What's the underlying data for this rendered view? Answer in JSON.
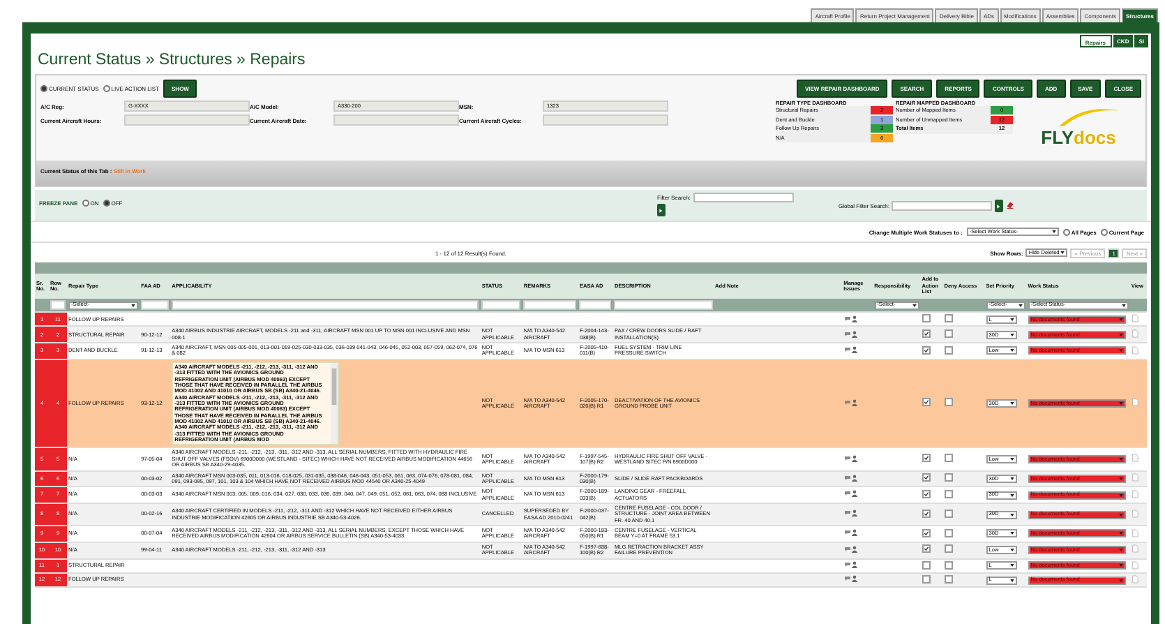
{
  "top_tabs": [
    {
      "label": "Aircraft Profile",
      "selected": false
    },
    {
      "label": "Return Project Management",
      "selected": false
    },
    {
      "label": "Delivery Bible",
      "selected": false
    },
    {
      "label": "ADs",
      "selected": false
    },
    {
      "label": "Modifications",
      "selected": false
    },
    {
      "label": "Assemblies",
      "selected": false
    },
    {
      "label": "Components",
      "selected": false
    },
    {
      "label": "Structures",
      "selected": true
    }
  ],
  "sub_tabs": [
    {
      "label": "Repairs",
      "selected": true
    },
    {
      "label": "CKD",
      "selected": false
    },
    {
      "label": "SI",
      "selected": false
    }
  ],
  "breadcrumb": "Current Status » Structures » Repairs",
  "view_options": [
    {
      "label": "CURRENT STATUS",
      "selected": true
    },
    {
      "label": "LIVE ACTION LIST",
      "selected": false
    }
  ],
  "show_button": "SHOW",
  "action_buttons": [
    "VIEW REPAIR DASHBOARD",
    "SEARCH",
    "REPORTS",
    "CONTROLS",
    "ADD",
    "SAVE",
    "CLOSE"
  ],
  "aircraft_fields": [
    {
      "label": "A/C Reg:",
      "value": "G-XXXX"
    },
    {
      "label": "A/C Model:",
      "value": "A330-200"
    },
    {
      "label": "MSN:",
      "value": "1323"
    },
    {
      "label": "Current Aircraft Hours:"
    },
    {
      "label": "Current Aircraft Date:"
    },
    {
      "label": "Current Aircraft Cycles:"
    }
  ],
  "repair_type_dashboard": {
    "title": "REPAIR TYPE DASHBOARD",
    "items": [
      {
        "label": "Structural Repairs",
        "count": "2",
        "color": "#e8242b"
      },
      {
        "label": "Dent and Buckle",
        "count": "1",
        "color": "#8fa6d6"
      },
      {
        "label": "Follow Up Repairs",
        "count": "3",
        "color": "#2e9b45"
      },
      {
        "label": "N/A",
        "count": "6",
        "color": "#f5a623"
      }
    ]
  },
  "repair_mapped_dashboard": {
    "title": "REPAIR MAPPED DASHBOARD",
    "items": [
      {
        "label": "Number of Mapped Items",
        "count": "0",
        "color": "#2e9b45"
      },
      {
        "label": "Number of Unmapped Items",
        "count": "12",
        "color": "#e8242b"
      }
    ],
    "total": {
      "label": "Total Items",
      "count": "12"
    }
  },
  "logo": {
    "part_1": "FLY",
    "part_2": "docs"
  },
  "tab_status": {
    "label": "Current Status of this Tab :",
    "value": "Still in Work"
  },
  "freeze_pane": {
    "label": "FREEZE PANE",
    "options": [
      {
        "label": "ON",
        "selected": false
      },
      {
        "label": "OFF",
        "selected": true
      }
    ]
  },
  "filter_search": {
    "label": "Filter Search:"
  },
  "global_filter_search": {
    "label": "Global Filter Search:"
  },
  "bulk_status": {
    "label": "Change Multiple Work Statuses to :",
    "select": "-Select Work Status-",
    "scopes": [
      {
        "label": "All Pages",
        "selected": false
      },
      {
        "label": "Current Page",
        "selected": false
      }
    ]
  },
  "results": "1 - 12 of 12 Result(s) Found.",
  "show_rows": {
    "label": "Show Rows:",
    "value": "Hide Deleted"
  },
  "pagination": {
    "previous": "« Previous",
    "pages": [
      {
        "label": "1",
        "selected": true
      }
    ],
    "next": "Next »"
  },
  "table": {
    "columns": [
      "Sr. No.",
      "Row No.",
      "Repair Type",
      "FAA AD",
      "APPLICABILITY",
      "STATUS",
      "REMARKS",
      "EASA AD",
      "DESCRIPTION",
      "Add Note",
      "Manage Issues",
      "Responsibility",
      "Add to Action List",
      "Deny Access",
      "Set Priority",
      "Work Status",
      "View"
    ],
    "filters": [
      {
        "kind": "none"
      },
      {
        "kind": "input"
      },
      {
        "kind": "select",
        "value": "-Select-"
      },
      {
        "kind": "input"
      },
      {
        "kind": "input"
      },
      {
        "kind": "input"
      },
      {
        "kind": "input"
      },
      {
        "kind": "input"
      },
      {
        "kind": "input"
      },
      {
        "kind": "none"
      },
      {
        "kind": "none"
      },
      {
        "kind": "select",
        "value": "-Select-"
      },
      {
        "kind": "none"
      },
      {
        "kind": "none"
      },
      {
        "kind": "select",
        "value": "-Select-"
      },
      {
        "kind": "select",
        "value": "-Select Status-"
      },
      {
        "kind": "none"
      }
    ],
    "rows": [
      {
        "sr": "1",
        "row": "11",
        "repair_type": "FOLLOW UP REPAIRS",
        "scrollable": false,
        "action_list": false,
        "deny_access": false,
        "priority": "L",
        "work_status": "No documents found",
        "selected": false
      },
      {
        "sr": "2",
        "row": "2",
        "repair_type": "STRUCTURAL REPAIR",
        "faa_ad": "90-12-12",
        "applicability": "A340 AIRBUS INDUSTRIE AIRCRAFT, MODELS -211 and -311, AIRCRAFT MSN 001 UP TO MSN 001 INCLUSIVE AND MSN 008-1",
        "scrollable": false,
        "status": "NOT APPLICABLE",
        "remarks": "N/A TO A340-542 AIRCRAFT",
        "easa_ad": "F-2004-143-038(B)",
        "description": "PAX / CREW DOORS SLIDE / RAFT INSTALLATION(S)",
        "action_list": true,
        "deny_access": false,
        "priority": "30D",
        "work_status": "No documents found",
        "selected": false
      },
      {
        "sr": "3",
        "row": "3",
        "repair_type": "DENT AND BUCKLE",
        "faa_ad": "91-12-13",
        "applicability": "A340 AIRCRAFT, MSN 005-005-001, 013-001-019-025-030-033-035, 036-039 041-043, 046-045, 052-003, 057-059, 062-074, 076 & 082",
        "scrollable": false,
        "status": "NOT APPLICABLE",
        "remarks": "N/A TO MSN 613",
        "easa_ad": "F-2005-410-011(B)",
        "description": "FUEL SYSTEM - TRIM LINE PRESSURE SWITCH",
        "action_list": true,
        "deny_access": false,
        "priority": "Low",
        "work_status": "No documents found",
        "selected": false
      },
      {
        "sr": "4",
        "row": "4",
        "repair_type": "FOLLOW UP REPAIRS",
        "faa_ad": "93-12-12",
        "applicability": "A340 AIRCRAFT MODELS -211, -212, -213, -311, -312 AND -313 FITTED WITH THE AVIONICS GROUND REFRIGERATION UNIT (AIRBUS MOD 40063) EXCEPT THOSE THAT HAVE RECEIVED IN PARALLEL THE AIRBUS MOD 41002 AND 41010 OR AIRBUS SB (SB) A340-21-4046. A340 AIRCRAFT MODELS -211, -212, -213, -311, -312 AND -313 FITTED WITH THE AVIONICS GROUND REFRIGERATION UNIT (AIRBUS MOD 40063) EXCEPT THOSE THAT HAVE RECEIVED IN PARALLEL THE AIRBUS MOD 41002 AND 41010 OR AIRBUS SB (SB) A340-21-4046. A340 AIRCRAFT MODELS -211, -212, -213, -311, -312 AND -313 FITTED WITH THE AVIONICS GROUND REFRIGERATION UNIT (AIRBUS MOD",
        "scrollable": true,
        "status": "NOT APPLICABLE",
        "remarks": "N/A TO A340-542 AIRCRAFT",
        "easa_ad": "F-2005-170-020(B) R1",
        "description": "DEACTIVATION OF THE AVIONICS GROUND PROBE UNIT",
        "action_list": true,
        "deny_access": false,
        "priority": "30D",
        "work_status": "No documents found",
        "selected": true
      },
      {
        "sr": "5",
        "row": "5",
        "repair_type": "N/A",
        "faa_ad": "97-05-04",
        "applicability": "A340 AIRCRAFT MODELS -211, -212, -213, -311, -312 AND -313, ALL SERIAL NUMBERS, FITTED WITH HYDRAULIC FIRE SHUT OFF VALVES (FSOV) 6900D000 (WESTLAND - SITEC) WHICH HAVE NOT RECEIVED AIRBUS MODIFICATION 44656 OR AIRBUS SB A340-29-4035.",
        "scrollable": false,
        "status": "NOT APPLICABLE",
        "remarks": "N/A TO A340-542 AIRCRAFT",
        "easa_ad": "F-1997-545-107(B) R2",
        "description": "HYDRAULIC FIRE SHUT OFF VALVE - WESTLAND SITEC P/N 6900D000",
        "action_list": true,
        "deny_access": false,
        "priority": "Low",
        "work_status": "No documents found",
        "selected": false
      },
      {
        "sr": "6",
        "row": "6",
        "repair_type": "N/A",
        "faa_ad": "00-03-02",
        "applicability": "A340 AIRCRAFT MSN 003-035, 011, 013-016, 018-025, 031-035, 038-046, 046-043, 051-053, 061, 063, 074-076, 078-081, 084, 091, 093-095, 097, 101, 103 & 104 WHICH HAVE NOT RECEIVED AIRBUS MOD 44540 OR A340-25-4049",
        "scrollable": false,
        "status": "NOT APPLICABLE",
        "remarks": "N/A TO MSN 613",
        "easa_ad": "F-2000-179-030(B)",
        "description": "SLIDE / SLIDE RAFT PACKBOARDS",
        "action_list": true,
        "deny_access": false,
        "priority": "30D",
        "work_status": "No documents found",
        "selected": false
      },
      {
        "sr": "7",
        "row": "7",
        "repair_type": "N/A",
        "faa_ad": "00-03-03",
        "applicability": "A340 AIRCRAFT MSN 003, 005, 009, 016, 034, 027, 030, 033, 036, 039, 040, 047, 049, 051, 052, 061, 063, 074, 088 INCLUSIVE",
        "scrollable": false,
        "status": "NOT APPLICABLE",
        "remarks": "N/A TO MSN 613",
        "easa_ad": "F-2000-189-033(B)",
        "description": "LANDING GEAR - FREEFALL ACTUATORS",
        "action_list": true,
        "deny_access": false,
        "priority": "30D",
        "work_status": "No documents found",
        "selected": false
      },
      {
        "sr": "8",
        "row": "8",
        "repair_type": "N/A",
        "faa_ad": "00-02-16",
        "applicability": "A340 AIRCRAFT CERTIFIED IN MODELS -211, -212, -311 AND -312 WHICH HAVE NOT RECEIVED EITHER AIRBUS INDUSTRIE MODIFICATION 42605 OR AIRBUS INDUSTRIE SB A340-53-4026.",
        "scrollable": false,
        "status": "CANCELLED",
        "remarks": "SUPERSEDED BY EASA AD 2010-0241",
        "easa_ad": "F-2000-037-042(B)",
        "description": "CENTRE FUSELAGE - COL DOOR / STRUCTURE - JOINT AREA BETWEEN FR. 40 AND 40.1",
        "action_list": true,
        "deny_access": false,
        "priority": "30D",
        "work_status": "No documents found",
        "selected": false
      },
      {
        "sr": "9",
        "row": "9",
        "repair_type": "N/A",
        "faa_ad": "00-07-04",
        "applicability": "A340 AIRCRAFT MODELS -211, -212, -213, -311, -312 AND -313, ALL SERIAL NUMBERS, EXCEPT THOSE WHICH HAVE RECEIVED AIRBUS MODIFICATION 42604 OR AIRBUS SERVICE BULLETIN (SB) A340-53-4033.",
        "scrollable": false,
        "status": "NOT APPLICABLE",
        "remarks": "N/A TO A340-542 AIRCRAFT",
        "easa_ad": "F-2000-183-050(B) R1",
        "description": "CENTRE FUSELAGE - VERTICAL BEAM Y=0 AT FRAME 53.1",
        "action_list": true,
        "deny_access": false,
        "priority": "30D",
        "work_status": "No documents found",
        "selected": false
      },
      {
        "sr": "10",
        "row": "10",
        "repair_type": "N/A",
        "faa_ad": "99-04-11",
        "applicability": "A340 AIRCRAFT MODELS -211, -212, -213, -311, -312 AND -313",
        "scrollable": false,
        "status": "NOT APPLICABLE",
        "remarks": "N/A TO A340-542 AIRCRAFT",
        "easa_ad": "F-1997-688-100(B) R2",
        "description": "MLG RETRACTION BRACKET ASSY FAILURE PREVENTION",
        "action_list": true,
        "deny_access": false,
        "priority": "Low",
        "work_status": "No documents found",
        "selected": false
      },
      {
        "sr": "11",
        "row": "1",
        "repair_type": "STRUCTURAL REPAIR",
        "scrollable": false,
        "action_list": false,
        "deny_access": false,
        "priority": "L",
        "work_status": "No documents found",
        "selected": false
      },
      {
        "sr": "12",
        "row": "12",
        "repair_type": "FOLLOW UP REPAIRS",
        "scrollable": false,
        "action_list": false,
        "deny_access": false,
        "priority": "L",
        "work_status": "No documents found",
        "selected": false
      }
    ]
  }
}
